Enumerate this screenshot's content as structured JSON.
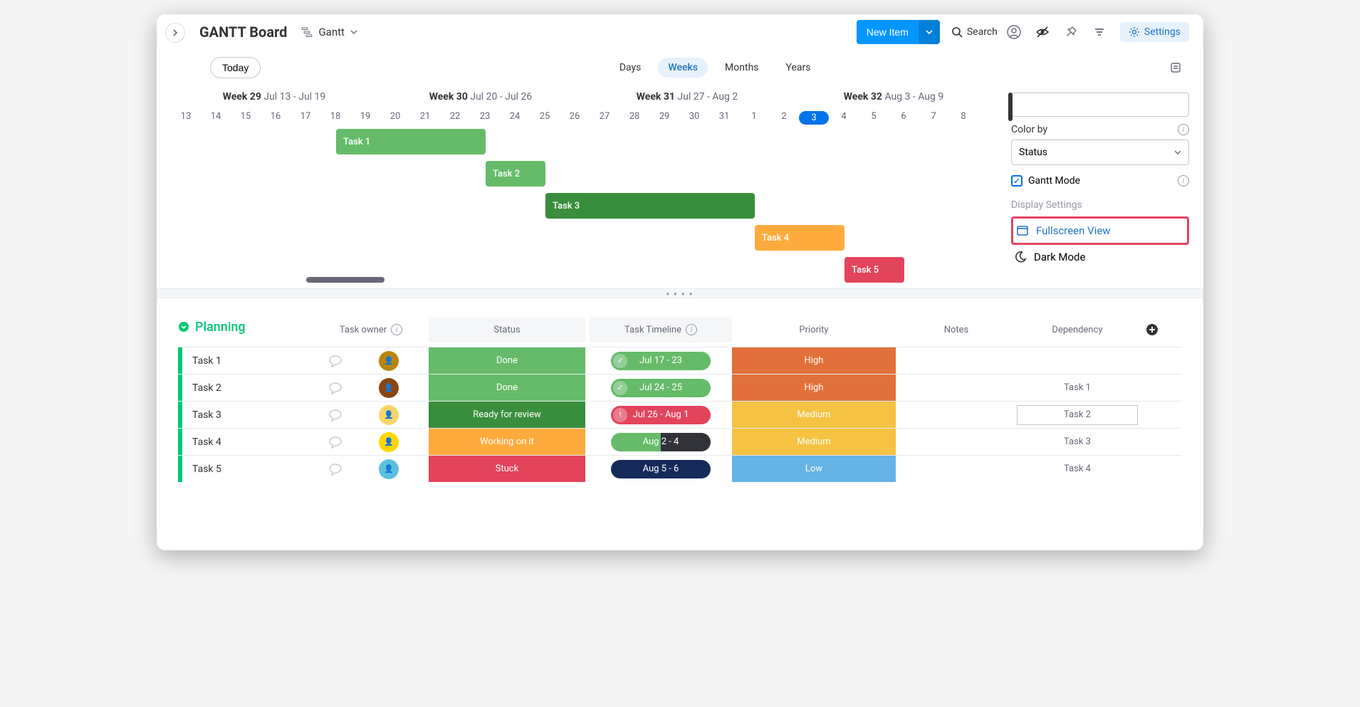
{
  "header": {
    "title": "GANTT Board",
    "view_name": "Gantt",
    "new_item": "New Item",
    "search": "Search",
    "settings": "Settings"
  },
  "controls": {
    "today": "Today",
    "scales": [
      "Days",
      "Weeks",
      "Months",
      "Years"
    ],
    "active_scale": "Weeks"
  },
  "gantt": {
    "weeks": [
      {
        "label": "Week 29",
        "range": "Jul 13 - Jul 19"
      },
      {
        "label": "Week 30",
        "range": "Jul 20 - Jul 26"
      },
      {
        "label": "Week 31",
        "range": "Jul 27 - Aug 2"
      },
      {
        "label": "Week 32",
        "range": "Aug 3 - Aug 9"
      }
    ],
    "days": [
      "13",
      "14",
      "15",
      "16",
      "17",
      "18",
      "19",
      "20",
      "21",
      "22",
      "23",
      "24",
      "25",
      "26",
      "27",
      "28",
      "29",
      "30",
      "31",
      "1",
      "2",
      "3",
      "4",
      "5",
      "6",
      "7",
      "8"
    ],
    "today_index": 21,
    "bars": [
      {
        "name": "Task 1",
        "color": "#66bb6a",
        "start": 6,
        "len": 5,
        "row": 0
      },
      {
        "name": "Task 2",
        "color": "#66bb6a",
        "start": 11,
        "len": 2,
        "row": 1
      },
      {
        "name": "Task 3",
        "color": "#388e3c",
        "start": 13,
        "len": 7,
        "row": 2
      },
      {
        "name": "Task 4",
        "color": "#fdab3d",
        "start": 20,
        "len": 3,
        "row": 3
      },
      {
        "name": "Task 5",
        "color": "#e2445c",
        "start": 23,
        "len": 2,
        "row": 4
      }
    ]
  },
  "panel": {
    "color_by_label": "Color by",
    "color_by_value": "Status",
    "gantt_mode": "Gantt Mode",
    "display_settings": "Display Settings",
    "fullscreen": "Fullscreen View",
    "dark_mode": "Dark Mode"
  },
  "group": {
    "name": "Planning",
    "columns": {
      "owner": "Task owner",
      "status": "Status",
      "timeline": "Task Timeline",
      "priority": "Priority",
      "notes": "Notes",
      "dependency": "Dependency"
    },
    "rows": [
      {
        "name": "Task 1",
        "avatar_bg": "#b8860b",
        "status": "Done",
        "status_color": "#66bb6a",
        "timeline": "Jul 17 - 23",
        "timeline_color": "#66bb6a",
        "timeline_icon": "check",
        "priority": "High",
        "priority_color": "#e2703a",
        "dep": ""
      },
      {
        "name": "Task 2",
        "avatar_bg": "#8b4513",
        "status": "Done",
        "status_color": "#66bb6a",
        "timeline": "Jul 24 - 25",
        "timeline_color": "#66bb6a",
        "timeline_icon": "check",
        "priority": "High",
        "priority_color": "#e2703a",
        "dep": "Task 1"
      },
      {
        "name": "Task 3",
        "avatar_bg": "#f8d568",
        "status": "Ready for review",
        "status_color": "#388e3c",
        "timeline": "Jul 26 - Aug 1",
        "timeline_color": "#e2445c",
        "timeline_icon": "bang",
        "priority": "Medium",
        "priority_color": "#f5c242",
        "dep": "Task 2",
        "dep_boxed": true
      },
      {
        "name": "Task 4",
        "avatar_bg": "#ffd700",
        "status": "Working on it",
        "status_color": "#fdab3d",
        "timeline": "Aug 2 - 4",
        "timeline_split": true,
        "timeline_color": "#66bb6a",
        "timeline_color2": "#323338",
        "priority": "Medium",
        "priority_color": "#f5c242",
        "dep": "Task 3"
      },
      {
        "name": "Task 5",
        "avatar_bg": "#5bc0de",
        "status": "Stuck",
        "status_color": "#e2445c",
        "timeline": "Aug 5 - 6",
        "timeline_color": "#162a5a",
        "priority": "Low",
        "priority_color": "#66b3e6",
        "dep": "Task 4"
      }
    ]
  }
}
